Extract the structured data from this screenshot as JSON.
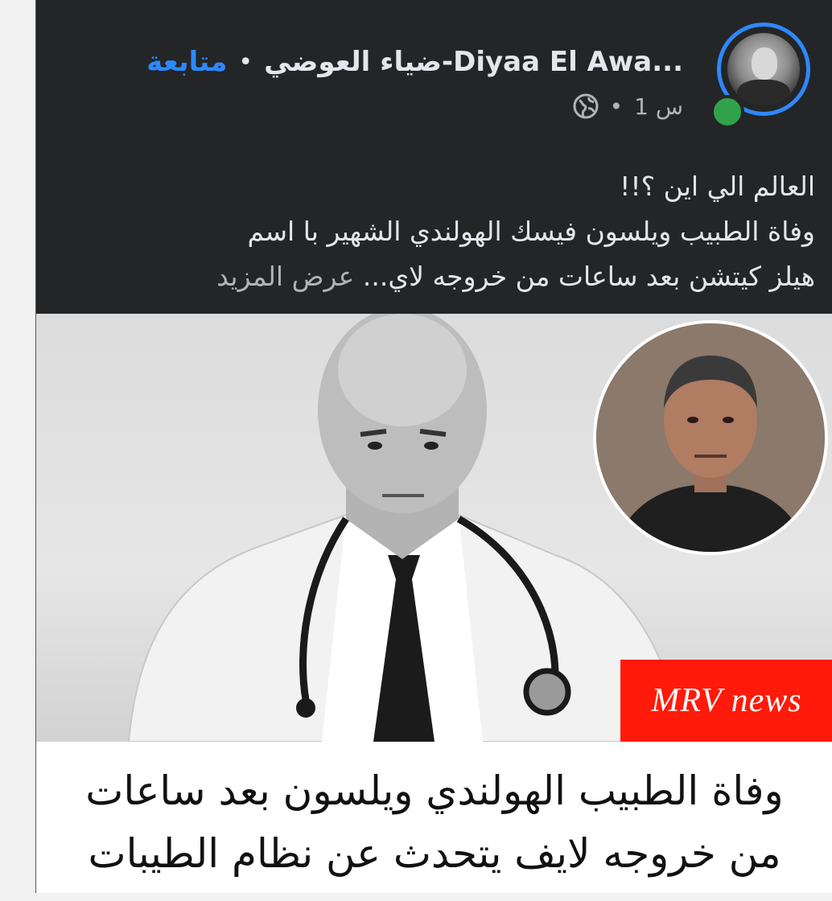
{
  "post": {
    "author": "ضياء العوضي-Diyaa El Awa...",
    "follow_label": "متابعة",
    "separator": "•",
    "time": "1 س",
    "audience_icon": "globe-icon",
    "text_lines": [
      "العالم الي اين ؟!!",
      "وفاة الطبيب ويلسون فيسك الهولندي الشهير  با اسم",
      "هيلز كيتشن بعد ساعات من خروجه لاي..."
    ],
    "see_more": "عرض المزيد"
  },
  "media": {
    "brand": "MRV news",
    "brand_color": "#ff1a0a",
    "headline_lines": [
      "وفاة الطبيب الهولندي ويلسون بعد ساعات",
      "من خروجه لايف يتحدث عن نظام الطيبات"
    ]
  },
  "colors": {
    "card_bg": "#242526",
    "link_blue": "#2d88ff",
    "online_green": "#31a24c"
  }
}
